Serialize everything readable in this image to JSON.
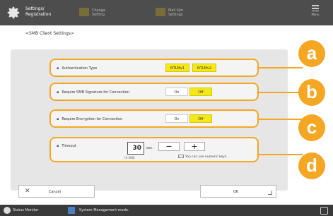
{
  "header": {
    "title": "Settings/\nRegistration",
    "shortcut1": "Change\nSetting",
    "shortcut2": "Mail Sim\nSettings",
    "menu_label": "Menu"
  },
  "page_title": "<SMB Client Settings>",
  "rows": {
    "auth": {
      "label": "Authentication Type",
      "opt1": "NTLMv1",
      "opt2": "NTLMv2"
    },
    "signature": {
      "label": "Require SMB Signature for Connection",
      "on": "On",
      "off": "Off"
    },
    "encryption": {
      "label": "Require Encryption for Connection",
      "on": "On",
      "off": "Off"
    },
    "timeout": {
      "label": "Timeout",
      "value": "30",
      "unit": "sec.",
      "range": "(3-300)",
      "minus": "−",
      "plus": "+",
      "hint": "You can use numeric keys."
    }
  },
  "callouts": {
    "a": "a",
    "b": "b",
    "c": "c",
    "d": "d"
  },
  "buttons": {
    "cancel": "Cancel",
    "cancel_icon": "✕",
    "ok": "OK"
  },
  "status": {
    "monitor": "Status Monitor",
    "system": "System Management mode."
  },
  "colors": {
    "highlight": "#f5a623",
    "selected": "#f5e81a",
    "header": "#4d4d4d"
  }
}
